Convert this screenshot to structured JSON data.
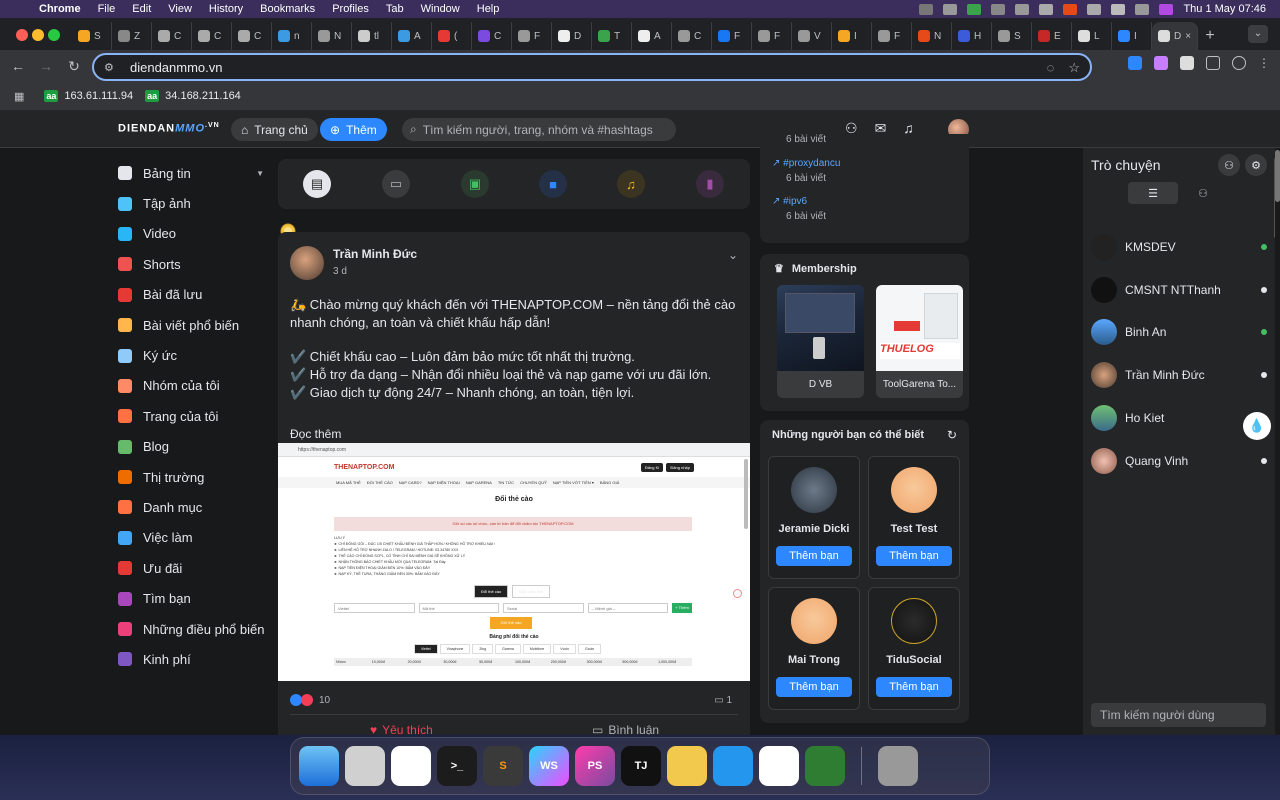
{
  "menubar": {
    "app": "Chrome",
    "items": [
      "File",
      "Edit",
      "View",
      "History",
      "Bookmarks",
      "Profiles",
      "Tab",
      "Window",
      "Help"
    ],
    "clock": "Thu 1 May  07:46"
  },
  "browser": {
    "tabs": [
      "S",
      "Z",
      "C",
      "C",
      "C",
      "n",
      "N",
      "tl",
      "A",
      "(",
      "C",
      "F",
      "D",
      "T",
      "A",
      "C",
      "F",
      "F",
      "V",
      "I",
      "F",
      "N",
      "H",
      "S",
      "E",
      "L",
      "I",
      "D"
    ],
    "url": "diendanmmo.vn",
    "bookmarks": [
      {
        "badge": "aa",
        "label": "163.61.111.94"
      },
      {
        "badge": "aa",
        "label": "34.168.211.164"
      }
    ]
  },
  "site": {
    "logo_main": "DIENDAN",
    "logo_mmo": "MMO",
    "logo_vn": ".VN",
    "home_label": "Trang chủ",
    "add_label": "Thêm",
    "search_placeholder": "Tìm kiếm người, trang, nhóm và #hashtags"
  },
  "left_nav": [
    {
      "label": "Bảng tin",
      "icon": "home-icon",
      "color": "#e4e6eb"
    },
    {
      "label": "Tập ảnh",
      "icon": "photo-album-icon",
      "color": "#4fc3f7"
    },
    {
      "label": "Video",
      "icon": "video-icon",
      "color": "#29b6f6"
    },
    {
      "label": "Shorts",
      "icon": "shorts-icon",
      "color": "#ef5350"
    },
    {
      "label": "Bài đã lưu",
      "icon": "bookmark-icon",
      "color": "#e53935"
    },
    {
      "label": "Bài viết phổ biến",
      "icon": "popular-icon",
      "color": "#ffb74d"
    },
    {
      "label": "Ký ức",
      "icon": "memory-icon",
      "color": "#90caf9"
    },
    {
      "label": "Nhóm của tôi",
      "icon": "group-icon",
      "color": "#ff8a65"
    },
    {
      "label": "Trang của tôi",
      "icon": "flag-icon",
      "color": "#ff7043"
    },
    {
      "label": "Blog",
      "icon": "blog-icon",
      "color": "#66bb6a"
    },
    {
      "label": "Thị trường",
      "icon": "market-icon",
      "color": "#ef6c00"
    },
    {
      "label": "Danh mục",
      "icon": "category-icon",
      "color": "#ff7043"
    },
    {
      "label": "Việc làm",
      "icon": "jobs-icon",
      "color": "#42a5f5"
    },
    {
      "label": "Ưu đãi",
      "icon": "offer-icon",
      "color": "#e53935"
    },
    {
      "label": "Tìm bạn",
      "icon": "find-friends-icon",
      "color": "#ab47bc"
    },
    {
      "label": "Những điều phổ biến",
      "icon": "trending-icon",
      "color": "#ec407a"
    },
    {
      "label": "Kinh phí",
      "icon": "funding-icon",
      "color": "#7e57c2"
    }
  ],
  "post": {
    "author": "Trần Minh Đức",
    "time": "3 d",
    "lines": [
      "🛵 Chào mừng quý khách đến với THENAPTOP.COM – nền tảng đổi thẻ cào nhanh chóng, an toàn và chiết khấu hấp dẫn!",
      "✔️ Chiết khấu cao – Luôn đảm bảo mức tốt nhất thị trường.",
      "✔️ Hỗ trợ đa dạng – Nhận đổi nhiều loại thẻ và nạp game với ưu đãi lớn.",
      "✔️ Giao dịch tự động 24/7 – Nhanh chóng, an toàn, tiện lợi."
    ],
    "read_more": "Đọc thêm",
    "reactions": "10",
    "comments": "1",
    "like_label": "Yêu thích",
    "comment_label": "Bình luận",
    "screenshot": {
      "url": "https://thenaptop.com",
      "brand": "THENAPTOP.COM",
      "btn_login": "Đăng Kí",
      "btn_register": "Đăng nhập",
      "menu": [
        "MUA MÃ THẺ",
        "ĐỔI THẺ CÀO",
        "NẠP CARD?",
        "NẠP ĐIỆN THOẠI",
        "NẠP GARENA",
        "TIN TỨC",
        "CHUYỂN QUỸ",
        "NẠP TIỀN VỚT TIỀN ▾",
        "BẢNG GIÁ"
      ],
      "title": "Đổi thẻ cào",
      "notice": "Giữ số các lợi chức, cần từ bản để đổi chăm tốc THENAPTOP.COM",
      "rules": [
        "LƯU Ý",
        "► CHỈ ĐÓNG GÓI – ĐÚC 1/5 CHIẾT KHẤU ĐÈNH GIÁ THẤP HƠN / KHÔNG HỖ TRỢ KHIẾU NẠI !",
        "► LIÊN HỆ HỖ TRỢ NHANH ZALO / TELEGRAM / HOTLINE: 03.34780 XXX",
        "► THẺ CÀO CHỈ ĐỔNG SCPL, CỐ TÌNH CHỈ SAI MỆNH GIÁ SẼ KHÔNG XỬ LÝ",
        "► NHẬN THÔNG BÁO CHIẾT KHẤU MỚI QUA TELEGRAM: Tại Đây",
        "► NẠP TIỀN ĐIỆN THOẠI GIẢM ĐẾN 10%: BẤM VÀO ĐÂY",
        "► NẠP KÝ, THẺ TURA, THÀNG GIẢM ĐẾN 30%: BẤM VÀO ĐÂY"
      ],
      "tabs": [
        "Đổi thẻ cào",
        "Đổi nhiều thẻ"
      ],
      "inputs": [
        "Viettel",
        "Mã thẻ",
        "Serial",
        "-- Mệnh giá --",
        "+ Thêm"
      ],
      "submit": "Gửi thẻ cào",
      "table_title": "Bảng phí đổi thẻ cào",
      "telcos": [
        "Viettel",
        "Vinaphone",
        "Zing",
        "Garena",
        "Mobifone",
        "Vcoin",
        "Gcoin"
      ],
      "head": [
        "Nhóm",
        "10,000đ",
        "20,000đ",
        "30,000đ",
        "50,000đ",
        "100,000đ",
        "200,000đ",
        "300,000đ",
        "500,000đ",
        "1,000,000đ"
      ]
    }
  },
  "hashtags": [
    {
      "tag": "",
      "count": "6 bài viết"
    },
    {
      "tag": "#proxydancu",
      "count": "6 bài viết"
    },
    {
      "tag": "#ipv6",
      "count": "6 bài viết"
    }
  ],
  "membership": {
    "title": "Membership",
    "items": [
      {
        "label": "D VB"
      },
      {
        "label": "ToolGarena To..."
      }
    ]
  },
  "friends": {
    "title": "Những người bạn có thể biết",
    "button": "Thêm bạn",
    "items": [
      {
        "name": "Jeramie Dicki"
      },
      {
        "name": "Test Test"
      },
      {
        "name": "Mai Trong"
      },
      {
        "name": "TiduSocial"
      }
    ]
  },
  "chat": {
    "title": "Trò chuyện",
    "search_placeholder": "Tìm kiếm người dùng",
    "contacts": [
      {
        "name": "KMSDEV",
        "online": true
      },
      {
        "name": "CMSNT NTThanh",
        "online": false
      },
      {
        "name": "Binh An",
        "online": true
      },
      {
        "name": "Trần Minh Đức",
        "online": false
      },
      {
        "name": "Ho Kiet",
        "online": false
      },
      {
        "name": "Quang Vinh",
        "online": false
      }
    ]
  },
  "dock": [
    "Finder",
    "Launchpad",
    "Chrome",
    "Terminal",
    "Sublime",
    "WS",
    "PS",
    "TJ",
    "Norton",
    "Docker",
    "Windows",
    "Game",
    "Trash"
  ]
}
